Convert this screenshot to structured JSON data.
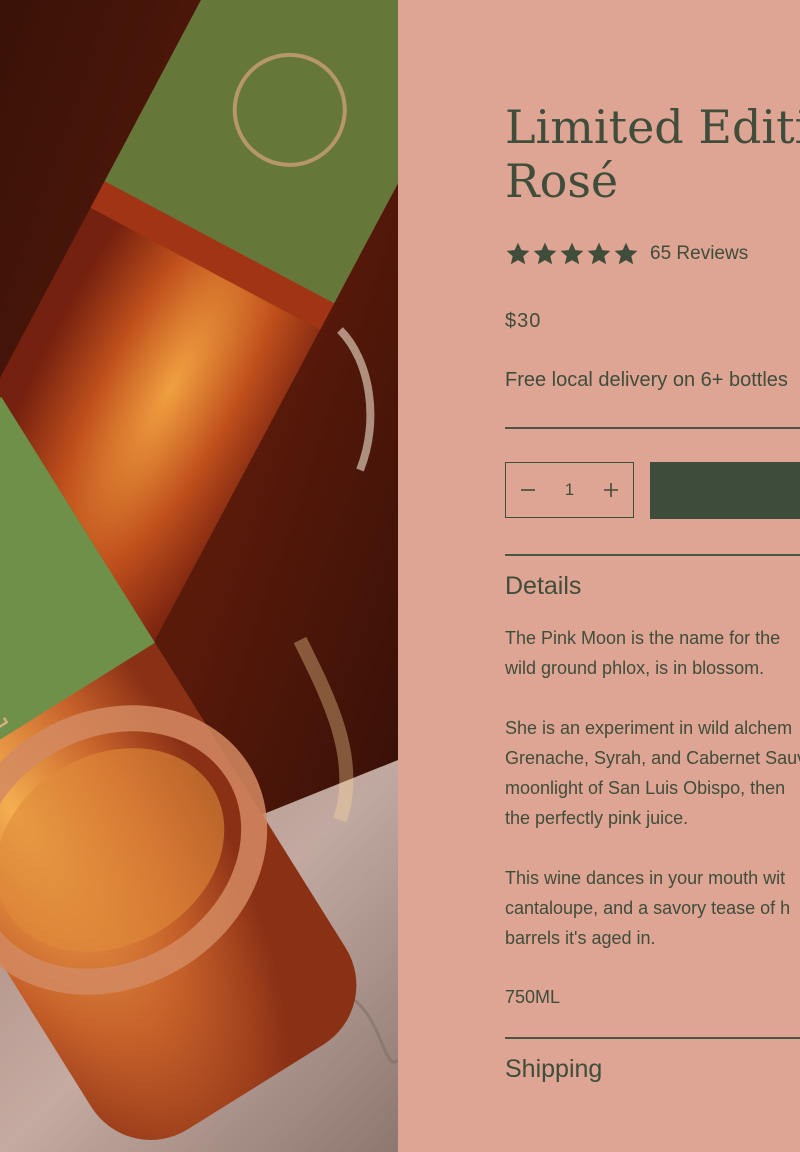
{
  "product": {
    "title_line1": "Limited Edition",
    "title_line2": "Rosé",
    "rating_value": 5,
    "rating_max": 5,
    "reviews_label": "65 Reviews",
    "price": "$30",
    "delivery_note": "Free local delivery on 6+ bottles",
    "quantity": "1"
  },
  "details": {
    "heading": "Details",
    "p1_l1": "The Pink Moon is the name for the",
    "p1_l2": "wild ground phlox, is in blossom.",
    "p2_l1": "She is an experiment in wild alchem",
    "p2_l2": "Grenache, Syrah, and Cabernet Sauv",
    "p2_l3": "moonlight of San Luis Obispo, then",
    "p2_l4": "the perfectly pink juice.",
    "p3_l1": "This wine dances in your mouth wit",
    "p3_l2": "cantaloupe, and a savory tease of h",
    "p3_l3": "barrels it's aged in.",
    "volume": "750ML"
  },
  "shipping": {
    "heading": "Shipping"
  },
  "colors": {
    "background": "#dea494",
    "text": "#3f4d3a",
    "button": "#3e4d3b"
  },
  "icons": [
    "star-icon",
    "minus-icon",
    "plus-icon"
  ]
}
